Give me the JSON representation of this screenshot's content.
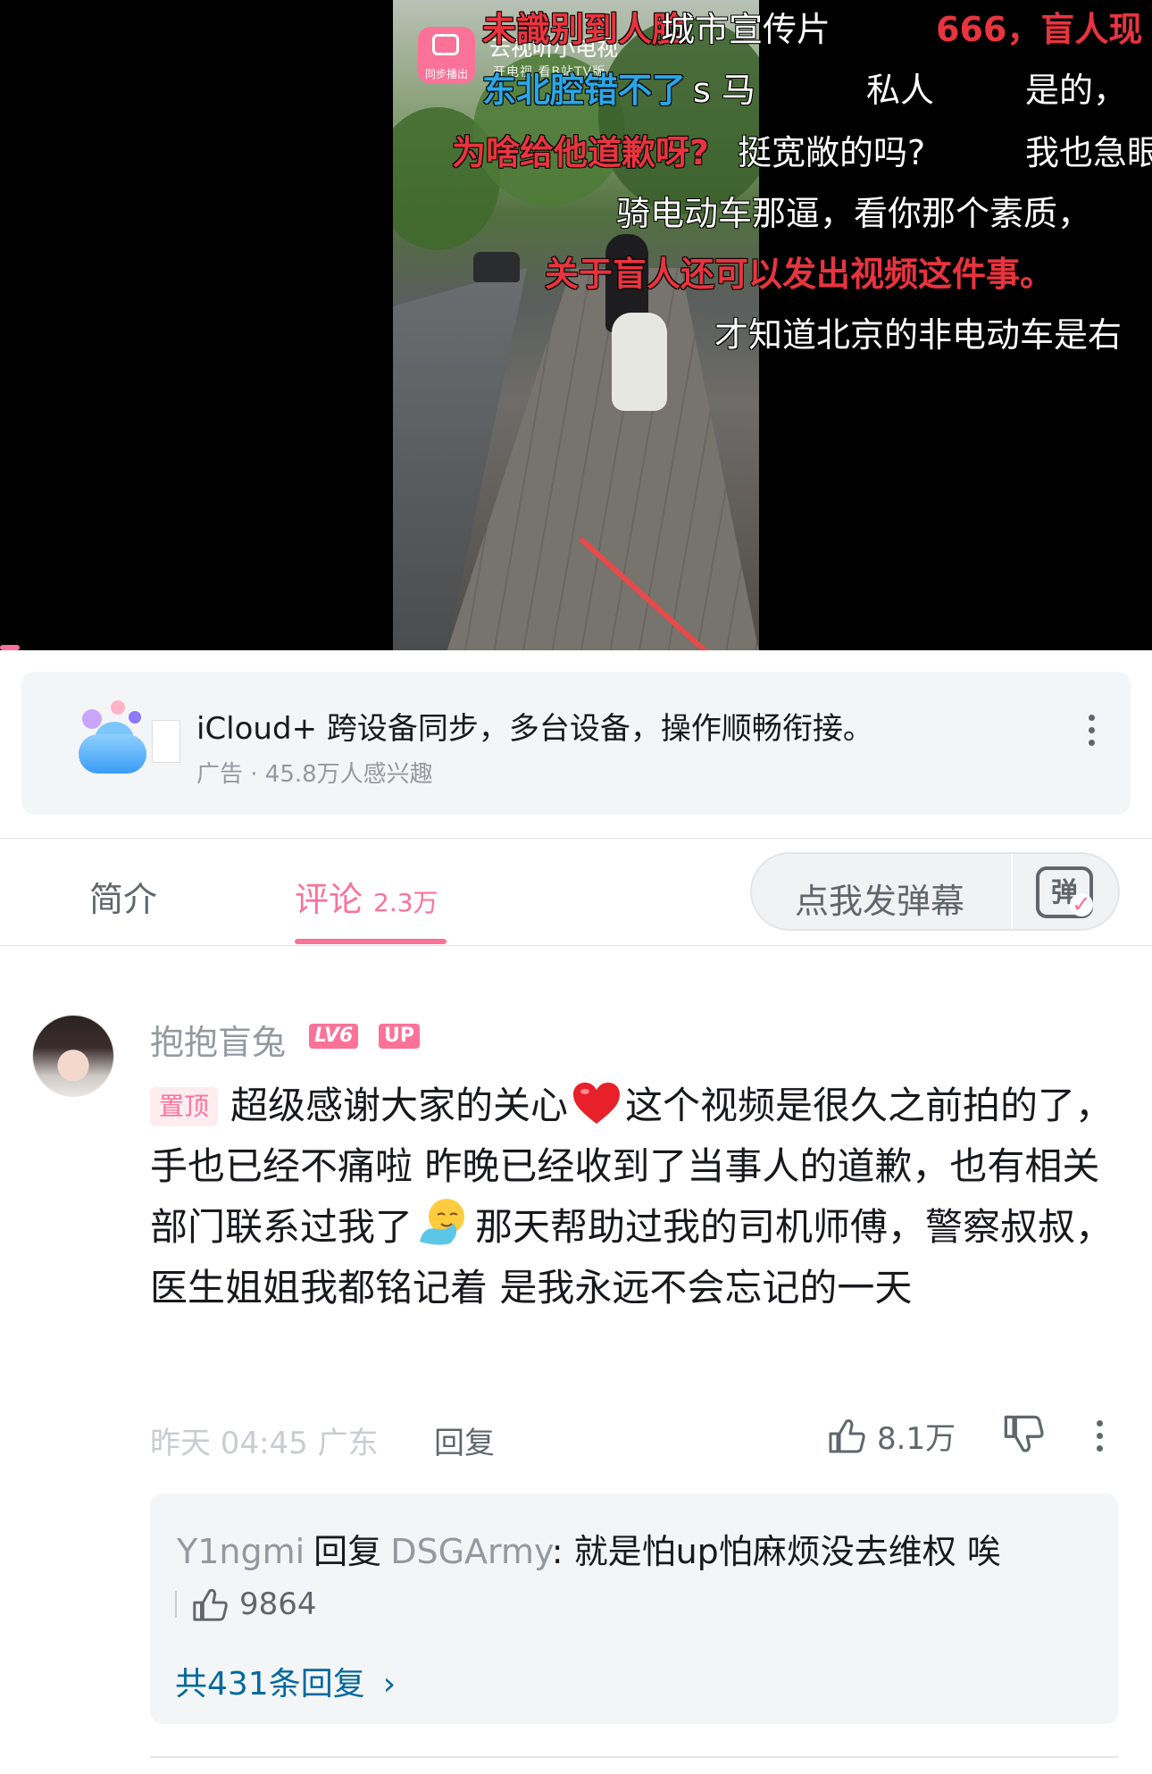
{
  "video": {
    "channel_name": "云视听小电视",
    "channel_sub": "开电视 看B站TV版",
    "channel_badge": "同步播出",
    "danmaku": [
      {
        "text": "未識别到人脸",
        "color": "#e8343f"
      },
      {
        "text": "城市宣传片",
        "color": "#ffffff"
      },
      {
        "text": "666，盲人现",
        "color": "#e8343f"
      },
      {
        "text": "东北腔错不了",
        "color": "#2aa6e8"
      },
      {
        "text": "s 马",
        "color": "#ffffff"
      },
      {
        "text": "私人",
        "color": "#ffffff"
      },
      {
        "text": "是的，",
        "color": "#ffffff"
      },
      {
        "text": "为啥给他道歉呀?",
        "color": "#e8343f"
      },
      {
        "text": "挺宽敞的吗?",
        "color": "#ffffff"
      },
      {
        "text": "我也急眼",
        "color": "#ffffff"
      },
      {
        "text": "骑电动车那逼，看你那个素质，",
        "color": "#ffffff"
      },
      {
        "text": "关于盲人还可以发出视频这件事。",
        "color": "#e8343f"
      },
      {
        "text": "才知道北京的非电动车是右",
        "color": "#ffffff"
      }
    ]
  },
  "ad": {
    "title": "iCloud+ 跨设备同步，多台设备，操作顺畅衔接。",
    "meta": "广告 · 45.8万人感兴趣",
    "more_icon": "more-vertical-icon"
  },
  "tabs": {
    "intro": "简介",
    "comments": "评论",
    "comments_count": "2.3万",
    "danmaku_placeholder": "点我发弹幕",
    "danmaku_toggle_glyph": "弹"
  },
  "comment": {
    "username": "抱抱盲兔",
    "level": "LV6",
    "up_badge": "UP",
    "pin_tag": "置顶",
    "text_part1": "超级感谢大家的关心",
    "text_part2": "这个视频是很久之前拍的了，手也已经不痛啦 昨晚已经收到了当事人的道歉，也有相关部门联系过我了",
    "text_part3": "那天帮助过我的司机师傅，警察叔叔，医生姐姐我都铭记着 是我永远不会忘记的一天",
    "time": "昨天 04:45 广东",
    "reply_label": "回复",
    "like_count": "8.1万",
    "colors": {
      "accent": "#fb7299",
      "link": "#00699d"
    }
  },
  "reply": {
    "user": "Y1ngmi",
    "verb": "回复",
    "target": "DSGArmy",
    "text": ": 就是怕up怕麻烦没去维权 唉",
    "like_count": "9864",
    "view_all": "共431条回复",
    "chevron": "›"
  }
}
